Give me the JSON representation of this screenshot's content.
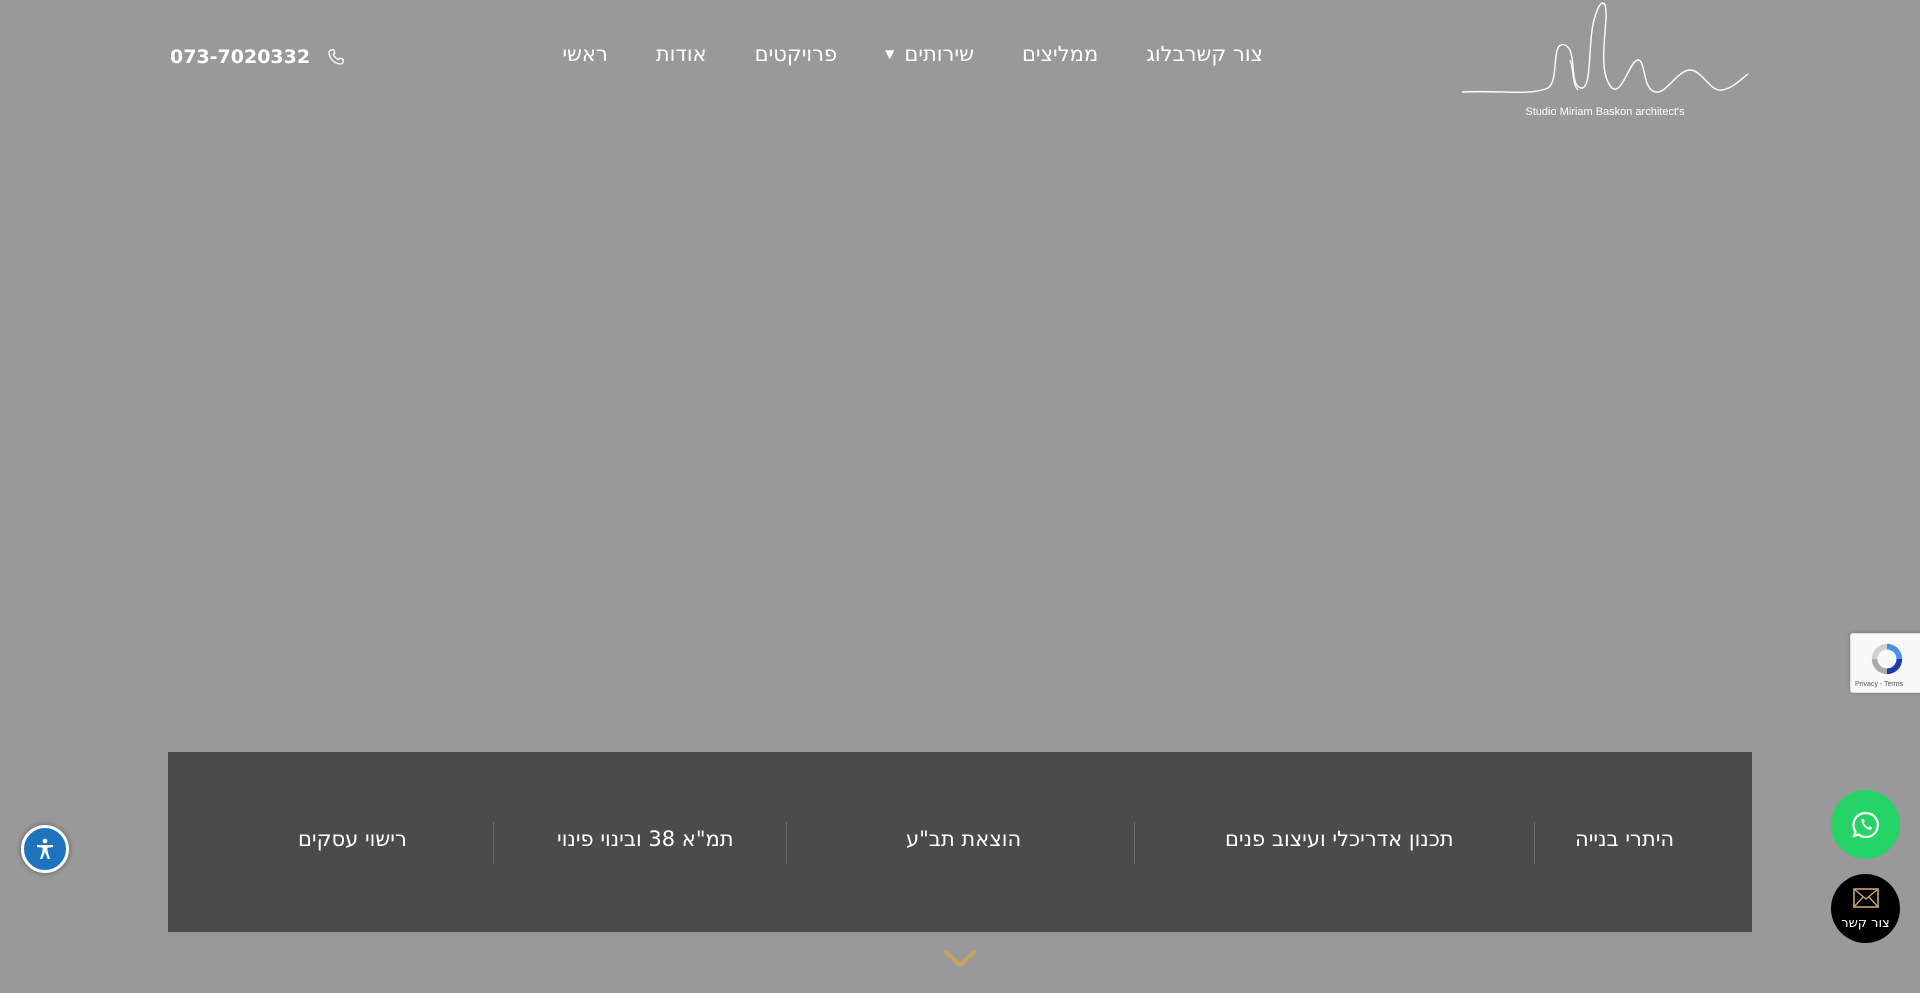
{
  "header": {
    "logo_text": "Studio Miriam Baskon architect's",
    "phone": "073-7020332",
    "nav": [
      {
        "label": "ראשי"
      },
      {
        "label": "אודות"
      },
      {
        "label": "פרויקטים"
      },
      {
        "label": "שירותים",
        "has_dropdown": true
      },
      {
        "label": "ממליצים"
      },
      {
        "label": "בלוג"
      },
      {
        "label": "צור קשר"
      }
    ]
  },
  "services": [
    {
      "label": "היתרי בנייה"
    },
    {
      "label": "תכנון אדריכלי ועיצוב פנים"
    },
    {
      "label": "הוצאת תב\"ע"
    },
    {
      "label": "תמ\"א 38 ובינוי פינוי"
    },
    {
      "label": "רישוי עסקים"
    }
  ],
  "floating": {
    "contact_label": "צור קשר",
    "recaptcha_text": "Privacy - Terms"
  },
  "colors": {
    "background": "#999999",
    "services_bar": "#4b4b4b",
    "chevron": "#c8a060",
    "whatsapp": "#25d366",
    "accessibility": "#1e73be"
  },
  "icons": [
    "phone-icon",
    "chevron-down-icon",
    "accessibility-icon",
    "whatsapp-icon",
    "envelope-icon",
    "recaptcha-icon"
  ]
}
